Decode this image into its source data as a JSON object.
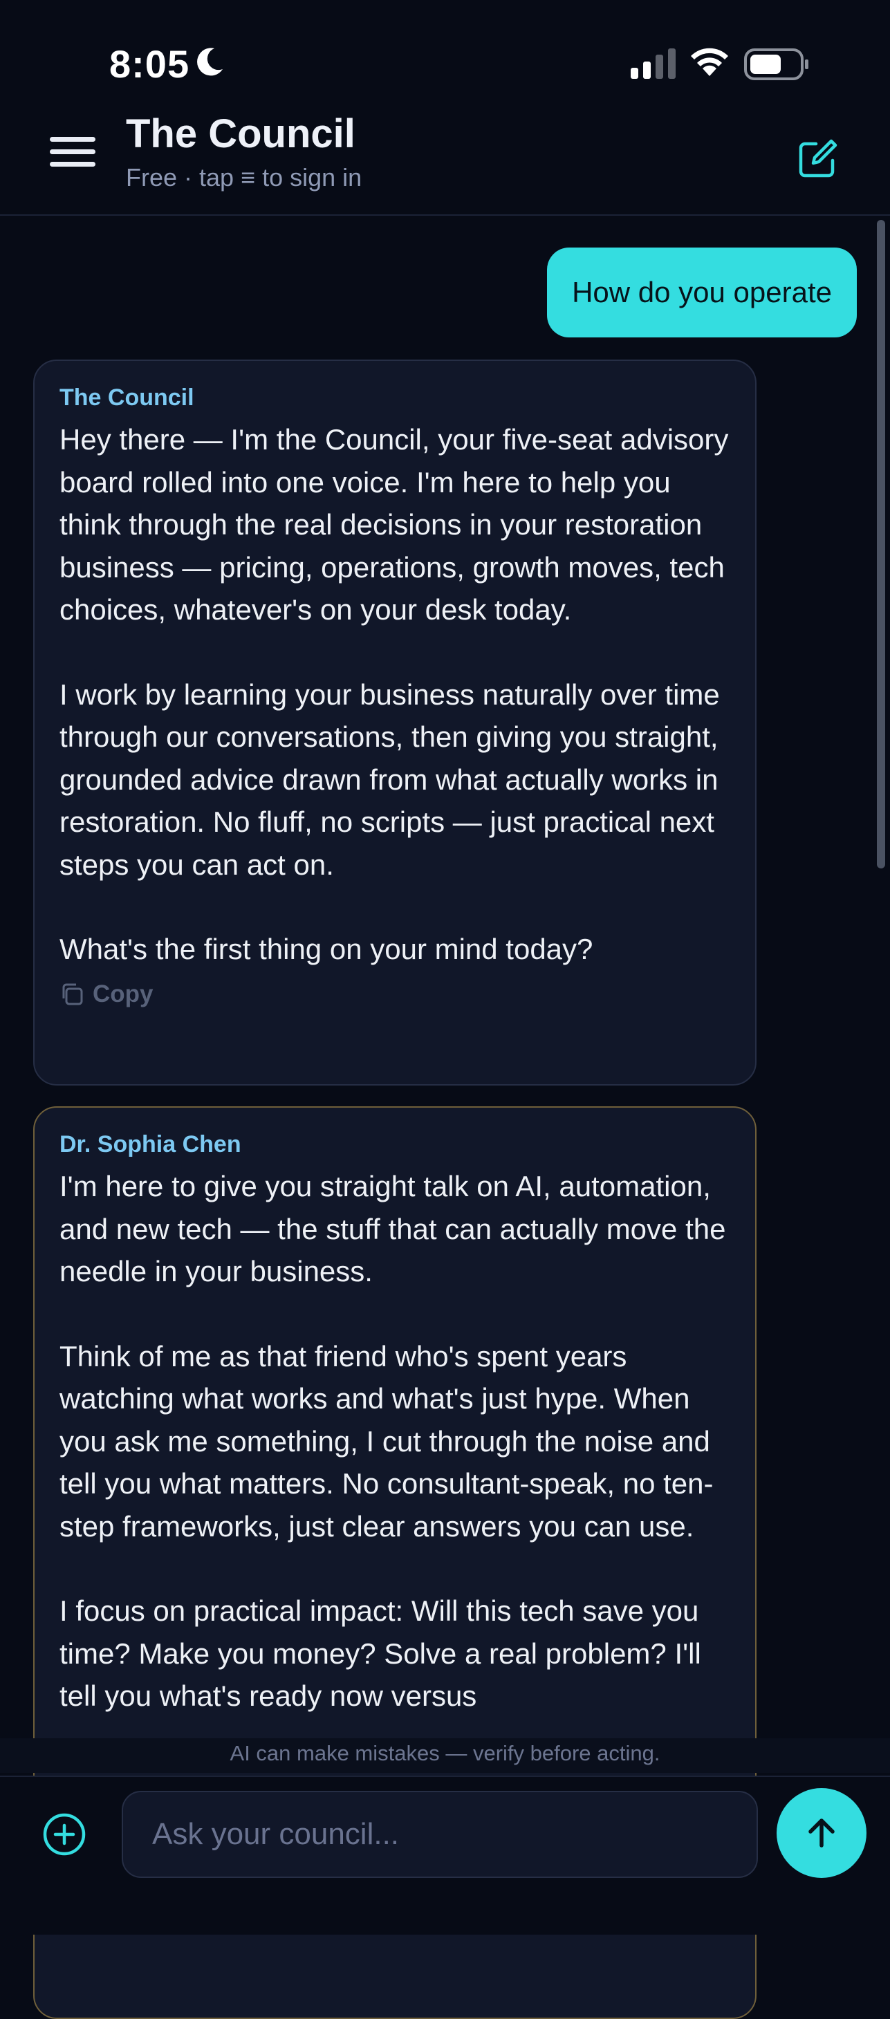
{
  "status_bar": {
    "time": "8:05"
  },
  "header": {
    "title": "The Council",
    "subtitle": "Free · tap ≡ to sign in"
  },
  "messages": {
    "user": {
      "text": "How do you operate"
    },
    "council": {
      "author": "The Council",
      "paragraphs": [
        "Hey there — I'm the Council, your five-seat advisory board rolled into one voice. I'm here to help you think through the real decisions in your restoration business — pricing, operations, growth moves, tech choices, whatever's on your desk today.",
        "I work by learning your business naturally over time through our conversations, then giving you straight, grounded advice drawn from what actually works in restoration. No fluff, no scripts — just practical next steps you can act on.",
        "What's the first thing on your mind today?"
      ],
      "copy_label": "Copy"
    },
    "sophia": {
      "author": "Dr. Sophia Chen",
      "paragraphs": [
        "I'm here to give you straight talk on AI, automation, and new tech — the stuff that can actually move the needle in your business.",
        "Think of me as that friend who's spent years watching what works and what's just hype. When you ask me something, I cut through the noise and tell you what matters. No consultant-speak, no ten-step frameworks, just clear answers you can use.",
        "I focus on practical impact: Will this tech save you time? Make you money? Solve a real problem? I'll tell you what's ready now versus"
      ]
    }
  },
  "footer": {
    "disclaimer": "AI can make mistakes — verify before acting.",
    "input_placeholder": "Ask your council..."
  },
  "colors": {
    "background": "#070b16",
    "accent": "#34dde0",
    "card": "#111729",
    "author_label": "#7dc9f2"
  },
  "icons": [
    "moon-icon",
    "signal-icon",
    "wifi-icon",
    "battery-icon",
    "menu-icon",
    "compose-icon",
    "copy-icon",
    "plus-circle-icon",
    "arrow-up-icon"
  ]
}
